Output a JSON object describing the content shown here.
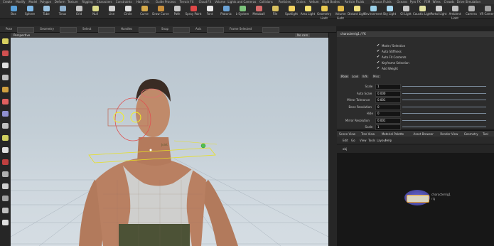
{
  "shelf": {
    "tabs": [
      "Create",
      "Modify",
      "Model",
      "Polygon",
      "Deform",
      "Texture",
      "Rigging",
      "Characters",
      "Constraints",
      "Hair Utils",
      "Guide Process",
      "Terrain FX",
      "Cloud FX",
      "Volume",
      "Lights and Cameras",
      "Collisions",
      "Particles",
      "Grains",
      "Vellum",
      "Rigid Bodies",
      "Particle Fluids",
      "Viscous Fluids",
      "Oceans",
      "Pyro FX",
      "FEM",
      "Wires",
      "Crowds",
      "Drive Simulation"
    ],
    "tools": [
      {
        "label": "Box",
        "icon": "box-icon",
        "color": "#5aa0d8"
      },
      {
        "label": "Sphere",
        "icon": "sphere-icon",
        "color": "#7fb8e6"
      },
      {
        "label": "Tube",
        "icon": "tube-icon",
        "color": "#9ac2e0"
      },
      {
        "label": "Torus",
        "icon": "torus-icon",
        "color": "#8fb0cc"
      },
      {
        "label": "Grid",
        "icon": "grid-icon",
        "color": "#c5c5c5"
      },
      {
        "label": "Null",
        "icon": "null-icon",
        "color": "#d9d98a"
      },
      {
        "label": "Line",
        "icon": "line-icon",
        "color": "#d0d0d0"
      },
      {
        "label": "Circle",
        "icon": "circle-icon",
        "color": "#e0e0e0"
      },
      {
        "label": "Curve",
        "icon": "curve-icon",
        "color": "#d4a84a"
      },
      {
        "label": "Draw Curve",
        "icon": "draw-curve-icon",
        "color": "#c98f3c"
      },
      {
        "label": "Path",
        "icon": "path-icon",
        "color": "#c9c9c9"
      },
      {
        "label": "Spray Paint",
        "icon": "spray-icon",
        "color": "#e04848"
      },
      {
        "label": "Font",
        "icon": "font-icon",
        "color": "#e8e8e8"
      },
      {
        "label": "Platonic",
        "icon": "platonic-icon",
        "color": "#6ba3d6"
      },
      {
        "label": "L-System",
        "icon": "lsystem-icon",
        "color": "#7cc37c"
      },
      {
        "label": "Metaball",
        "icon": "metaball-icon",
        "color": "#d66b6b"
      },
      {
        "label": "File",
        "icon": "file-icon",
        "color": "#d8c060"
      },
      {
        "label": "Spotlight",
        "icon": "spotlight-icon",
        "color": "#f0d060"
      },
      {
        "label": "Area Light",
        "icon": "area-light-icon",
        "color": "#f4e070"
      },
      {
        "label": "Geometry Light",
        "icon": "geo-light-icon",
        "color": "#e8c850"
      },
      {
        "label": "Volume Light",
        "icon": "vol-light-icon",
        "color": "#e0b848"
      },
      {
        "label": "Distant Light",
        "icon": "distant-light-icon",
        "color": "#f0e080"
      },
      {
        "label": "Environment",
        "icon": "env-light-icon",
        "color": "#9ad0e8"
      },
      {
        "label": "Sky Light",
        "icon": "sky-light-icon",
        "color": "#a8d8f0"
      },
      {
        "label": "GI Light",
        "icon": "gi-light-icon",
        "color": "#c8c8c8"
      },
      {
        "label": "Caustic Light",
        "icon": "caustic-light-icon",
        "color": "#e0e0a0"
      },
      {
        "label": "Portal Light",
        "icon": "portal-light-icon",
        "color": "#d0d0d0"
      },
      {
        "label": "Ambient Light",
        "icon": "ambient-light-icon",
        "color": "#c0c0c0"
      },
      {
        "label": "Camera",
        "icon": "camera-icon",
        "color": "#b0b0b0"
      },
      {
        "label": "VR Camera",
        "icon": "vr-camera-icon",
        "color": "#a0a0a0"
      }
    ]
  },
  "toolbar3": {
    "items": [
      "Pose",
      "Geometry",
      "Select",
      "Handles",
      "Snap",
      "Axis",
      "Frame Selected"
    ]
  },
  "viewport": {
    "header_label": "Perspective",
    "cam_label": "No cam",
    "joint_label": "Joint"
  },
  "params": {
    "title": "characterrig1 / FK",
    "tabs": [
      "Pose",
      "Look",
      "Ikfk",
      "Misc"
    ],
    "checks": [
      {
        "label": "Mode / Selection"
      },
      {
        "label": "Auto Stiffness"
      },
      {
        "label": "Auto Fit Contents"
      },
      {
        "label": "Keyframe Selection"
      },
      {
        "label": "Add Weight"
      }
    ],
    "rows": [
      {
        "label": "Scale",
        "value": "1"
      },
      {
        "label": "Auto Scale",
        "value": "0.000"
      },
      {
        "label": "Mirror Tolerance",
        "value": "0.001"
      },
      {
        "label": "Bone Resolution",
        "value": "0"
      },
      {
        "label": "Hide",
        "value": "0"
      },
      {
        "label": "Mirror Resolution",
        "value": "0.001"
      },
      {
        "label": "Scale",
        "value": "1"
      }
    ]
  },
  "network": {
    "tabs": [
      "Scene View",
      "Tree View",
      "Material Palette",
      "Asset Browser",
      "Render View",
      "Geometry",
      "Tool"
    ],
    "menus": [
      "Edit",
      "Go",
      "View",
      "Tools",
      "Layout",
      "Help"
    ],
    "path": "obj",
    "node_name": "characterrig1",
    "node_type": "rig"
  }
}
